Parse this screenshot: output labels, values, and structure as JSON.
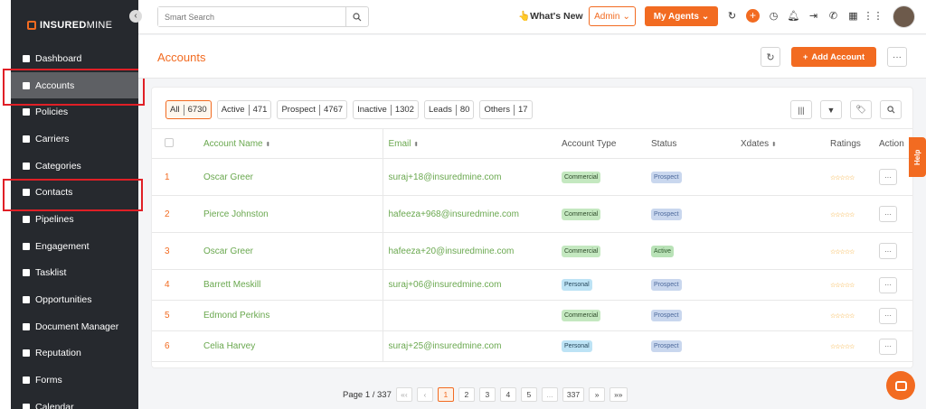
{
  "brand": {
    "logo_bold": "INSURED",
    "logo_light": "MINE"
  },
  "sidebar": {
    "items": [
      {
        "label": "Dashboard",
        "icon": "dashboard-icon"
      },
      {
        "label": "Accounts",
        "icon": "user-icon",
        "active": true
      },
      {
        "label": "Policies",
        "icon": "policies-icon"
      },
      {
        "label": "Carriers",
        "icon": "bank-icon"
      },
      {
        "label": "Categories",
        "icon": "layers-icon"
      },
      {
        "label": "Contacts",
        "icon": "contact-card-icon"
      },
      {
        "label": "Pipelines",
        "icon": "filter-icon"
      },
      {
        "label": "Engagement",
        "icon": "megaphone-icon"
      },
      {
        "label": "Tasklist",
        "icon": "tasks-icon"
      },
      {
        "label": "Opportunities",
        "icon": "bar-chart-icon"
      },
      {
        "label": "Document Manager",
        "icon": "folder-icon"
      },
      {
        "label": "Reputation",
        "icon": "handshake-icon"
      },
      {
        "label": "Forms",
        "icon": "form-icon"
      },
      {
        "label": "Calendar",
        "icon": "calendar-icon"
      }
    ]
  },
  "topbar": {
    "search_placeholder": "Smart Search",
    "whats_new": "What's New",
    "admin_label": "Admin",
    "agents_label": "My Agents"
  },
  "page": {
    "title": "Accounts",
    "add_button": "Add Account"
  },
  "filters": [
    {
      "label": "All",
      "count": "6730",
      "active": true
    },
    {
      "label": "Active",
      "count": "471"
    },
    {
      "label": "Prospect",
      "count": "4767"
    },
    {
      "label": "Inactive",
      "count": "1302"
    },
    {
      "label": "Leads",
      "count": "80"
    },
    {
      "label": "Others",
      "count": "17"
    }
  ],
  "table": {
    "headers": {
      "name": "Account Name",
      "email": "Email",
      "type": "Account Type",
      "status": "Status",
      "xdates": "Xdates",
      "ratings": "Ratings",
      "action": "Action"
    },
    "rows": [
      {
        "idx": "1",
        "name": "Oscar Greer",
        "email": "suraj+18@insuredmine.com",
        "type": "Commercial",
        "status": "Prospect",
        "stars": "☆☆☆☆☆"
      },
      {
        "idx": "2",
        "name": "Pierce Johnston",
        "email": "hafeeza+968@insuredmine.com",
        "type": "Commercial",
        "status": "Prospect",
        "stars": "☆☆☆☆☆"
      },
      {
        "idx": "3",
        "name": "Oscar Greer",
        "email": "hafeeza+20@insuredmine.com",
        "type": "Commercial",
        "status": "Active",
        "stars": "☆☆☆☆☆"
      },
      {
        "idx": "4",
        "name": "Barrett Meskill",
        "email": "suraj+06@insuredmine.com",
        "type": "Personal",
        "status": "Prospect",
        "stars": "☆☆☆☆☆"
      },
      {
        "idx": "5",
        "name": "Edmond Perkins",
        "email": "",
        "type": "Commercial",
        "status": "Prospect",
        "stars": "☆☆☆☆☆"
      },
      {
        "idx": "6",
        "name": "Celia Harvey",
        "email": "suraj+25@insuredmine.com",
        "type": "Personal",
        "status": "Prospect",
        "stars": "☆☆☆☆☆"
      }
    ]
  },
  "pagination": {
    "label": "Page 1 / 337",
    "first": "«‹",
    "prev": "‹",
    "pages": [
      "1",
      "2",
      "3",
      "4",
      "5",
      "...",
      "337"
    ],
    "next": "»",
    "last": "»»"
  },
  "help_label": "Help",
  "colors": {
    "accent": "#f26b21",
    "sidebar": "#26292e",
    "link_green": "#6aa84f"
  }
}
